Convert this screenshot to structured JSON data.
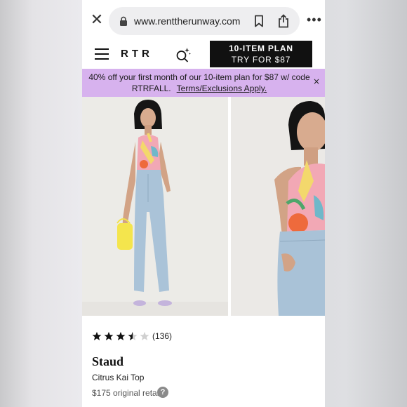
{
  "browser": {
    "url": "www.renttherunway.com",
    "close_glyph": "✕",
    "more_glyph": "•••"
  },
  "header": {
    "logo": "RTR",
    "cta_line1": "10-ITEM PLAN",
    "cta_line2": "TRY FOR $87"
  },
  "promo": {
    "text": "40% off your first month of our 10-item plan for $87 w/ code RTRFALL.",
    "link": "Terms/Exclusions Apply.",
    "close_glyph": "×"
  },
  "product": {
    "rating": 3.5,
    "rating_max": 5,
    "review_count": "(136)",
    "brand": "Staud",
    "name": "Citrus Kai Top",
    "price": "$175 original retail",
    "help_glyph": "?"
  },
  "colors": {
    "promo_bg": "#d7b2ee",
    "cta_bg": "#111111",
    "star_fill": "#111111",
    "star_empty": "#d0d0d0"
  }
}
